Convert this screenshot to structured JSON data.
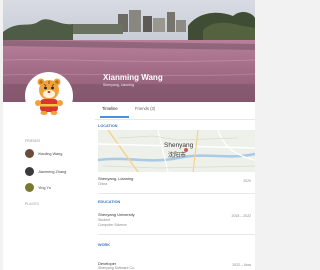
{
  "profile": {
    "name": "Xianming Wang",
    "subtitle": "Shenyang, Liaoning"
  },
  "tabs": [
    {
      "label": "Timeline"
    },
    {
      "label": "Friends (3)"
    }
  ],
  "sidebar": {
    "friends_heading": "FRIENDS",
    "friends": [
      {
        "name": "Xiaoling Wang",
        "color": "#6b4a3a"
      },
      {
        "name": "Jianmeng Zhang",
        "color": "#3a3a3a"
      },
      {
        "name": "Ying Yu",
        "color": "#7a7a2e"
      }
    ],
    "places_heading": "PLACES"
  },
  "sections": {
    "location_heading": "LOCATION",
    "map": {
      "city_en": "Shenyang",
      "city_zh": "沈阳市"
    },
    "location_line": "Shenyang, Liaoning",
    "location_country": "China",
    "location_date": "2020",
    "education_heading": "EDUCATION",
    "edu_school": "Shenyang University",
    "edu_detail_1": "Student",
    "edu_detail_2": "Computer Science",
    "edu_date": "2018 – 2022",
    "work_heading": "WORK",
    "work_title": "Developer",
    "work_detail": "Shenyang Software Co.",
    "work_date": "2022 – Now"
  },
  "colors": {
    "accent": "#4a90e2",
    "section_heading": "#3a78c2"
  }
}
